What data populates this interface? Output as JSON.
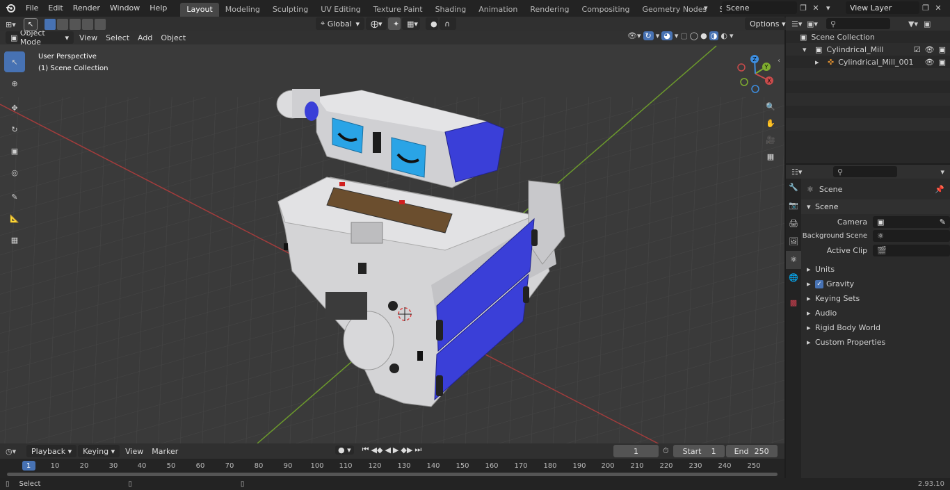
{
  "topbar": {
    "menus": [
      "File",
      "Edit",
      "Render",
      "Window",
      "Help"
    ],
    "tabs": [
      "Layout",
      "Modeling",
      "Sculpting",
      "UV Editing",
      "Texture Paint",
      "Shading",
      "Animation",
      "Rendering",
      "Compositing",
      "Geometry Nodes",
      "Scripting"
    ],
    "active_tab": "Layout",
    "scene_name": "Scene",
    "view_layer": "View Layer"
  },
  "viewport_header": {
    "mode": "Object Mode",
    "menus": [
      "View",
      "Select",
      "Add",
      "Object"
    ],
    "orientation": "Global",
    "options_label": "Options"
  },
  "viewport": {
    "perspective_label": "User Perspective",
    "collection_label": "(1) Scene Collection",
    "gizmo_axes": {
      "x": "X",
      "y": "Y",
      "z": "Z"
    }
  },
  "outliner": {
    "root": "Scene Collection",
    "collection": "Cylindrical_Mill",
    "object": "Cylindrical_Mill_001"
  },
  "properties": {
    "context_title": "Scene",
    "panel_title": "Scene",
    "fields": [
      {
        "label": "Camera",
        "value": ""
      },
      {
        "label": "Background Scene",
        "value": ""
      },
      {
        "label": "Active Clip",
        "value": ""
      }
    ],
    "sections": [
      "Units",
      "Gravity",
      "Keying Sets",
      "Audio",
      "Rigid Body World",
      "Custom Properties"
    ]
  },
  "timeline": {
    "menus": [
      "Playback",
      "Keying",
      "View",
      "Marker"
    ],
    "current_frame": "1",
    "start_label": "Start",
    "start": "1",
    "end_label": "End",
    "end": "250",
    "ruler": [
      "1",
      "10",
      "20",
      "30",
      "40",
      "50",
      "60",
      "70",
      "80",
      "90",
      "100",
      "110",
      "120",
      "130",
      "140",
      "150",
      "160",
      "170",
      "180",
      "190",
      "200",
      "210",
      "220",
      "230",
      "240",
      "250"
    ]
  },
  "statusbar": {
    "left": "Select",
    "version": "2.93.10"
  },
  "colors": {
    "accent": "#4772b3",
    "x_axis": "#c84b4b",
    "y_axis": "#7fae2e",
    "z_axis": "#3d8ee0",
    "model_blue": "#3a3fd8"
  }
}
